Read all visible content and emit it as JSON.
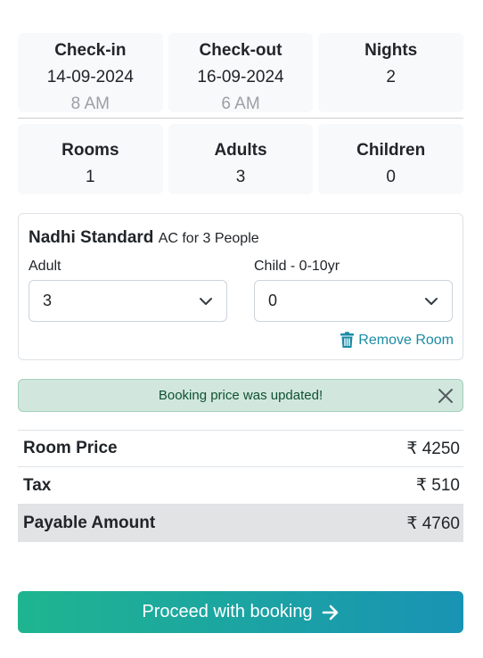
{
  "stay": {
    "checkin": {
      "label": "Check-in",
      "date": "14-09-2024",
      "time": "8 AM"
    },
    "checkout": {
      "label": "Check-out",
      "date": "16-09-2024",
      "time": "6 AM"
    },
    "nights": {
      "label": "Nights",
      "value": "2"
    }
  },
  "occupancy": {
    "rooms": {
      "label": "Rooms",
      "value": "1"
    },
    "adults": {
      "label": "Adults",
      "value": "3"
    },
    "children": {
      "label": "Children",
      "value": "0"
    }
  },
  "room": {
    "name": "Nadhi Standard",
    "description": "AC for 3 People",
    "adult_label": "Adult",
    "adult_value": "3",
    "child_label": "Child - 0-10yr",
    "child_value": "0",
    "remove_label": "Remove Room"
  },
  "alert": {
    "message": "Booking price was updated!"
  },
  "pricing": {
    "room_price_label": "Room Price",
    "room_price_value": "₹ 4250",
    "tax_label": "Tax",
    "tax_value": "₹ 510",
    "payable_label": "Payable Amount",
    "payable_value": "₹ 4760"
  },
  "actions": {
    "proceed_label": "Proceed with booking"
  },
  "colors": {
    "accent": "#1a8ba5",
    "button_gradient_start": "#1fb590",
    "button_gradient_end": "#1993b4",
    "alert_bg": "#d1e7dd"
  },
  "icons": {
    "select": "chevron-down-icon",
    "remove": "trash-icon",
    "close": "close-icon",
    "proceed": "arrow-right-icon"
  }
}
